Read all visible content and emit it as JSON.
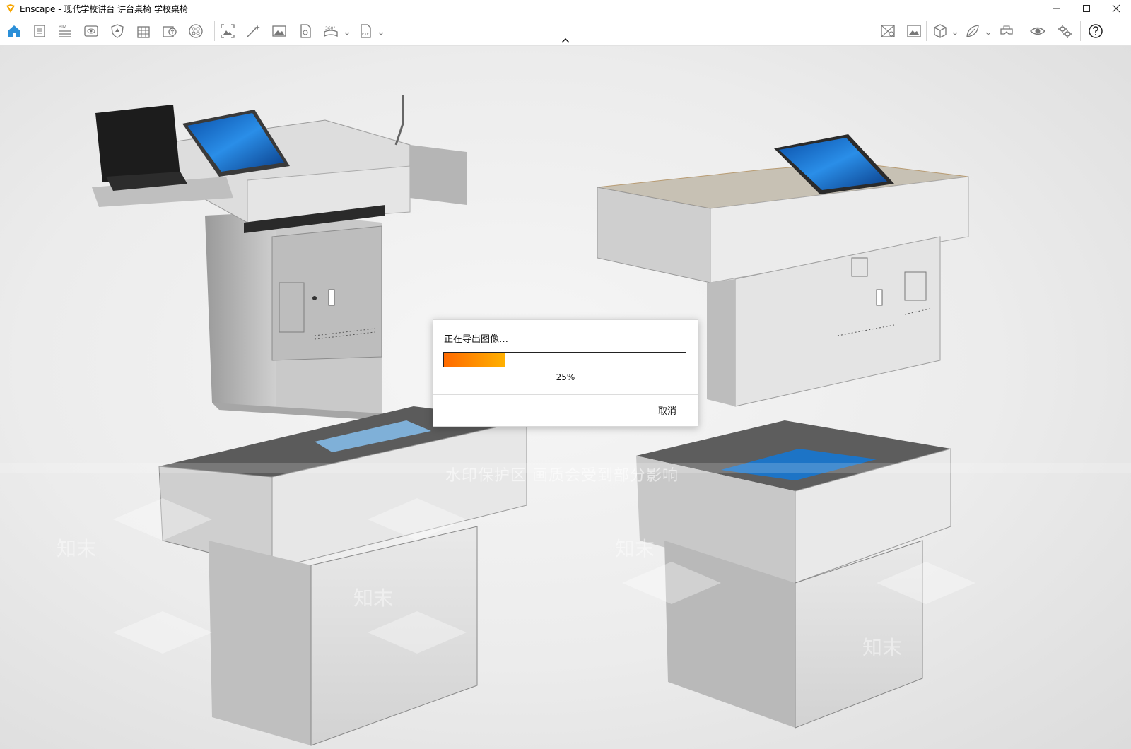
{
  "window": {
    "title": "Enscape - 现代学校讲台 讲台桌椅 学校桌椅",
    "brand_color": "#f7a600"
  },
  "toolbar": {
    "left_icons": [
      "home-icon",
      "assets-icon",
      "bim-icon",
      "views-icon",
      "shield-icon",
      "building-icon",
      "upload-icon",
      "material-icon",
      "screenshot-icon",
      "magic-wand-icon",
      "image-icon",
      "export-icon",
      "panorama-360-icon",
      "exe-export-icon"
    ],
    "right_icons": [
      "map-icon",
      "gallery-icon",
      "cube-icon",
      "leaf-icon",
      "vr-headset-icon",
      "eye-icon",
      "settings-icon",
      "help-icon"
    ],
    "bim_label": "BIM",
    "pano_label": "360°",
    "exe_label": "EXE"
  },
  "viewport": {
    "watermark_notice": "水印保护区  画质会受到部分影响",
    "watermark_brand": "知末"
  },
  "dialog": {
    "message": "正在导出图像…",
    "progress_percent": 25,
    "progress_label": "25%",
    "cancel_label": "取消",
    "progress_colors": [
      "#ff6a00",
      "#ffb000"
    ]
  }
}
